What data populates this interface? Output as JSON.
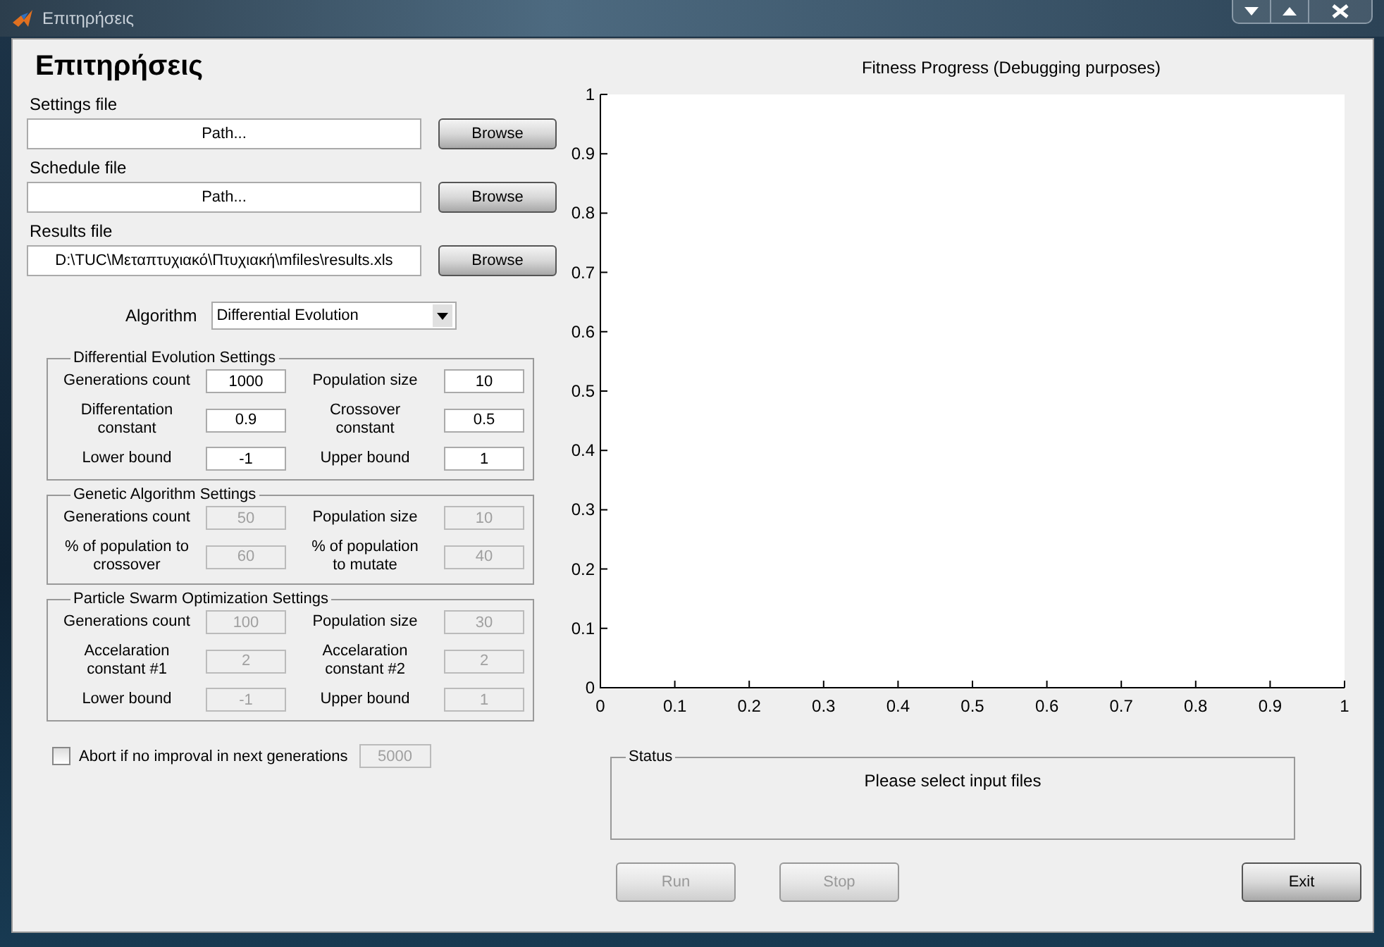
{
  "window": {
    "title": "Επιτηρήσεις"
  },
  "heading": "Επιτηρήσεις",
  "files": [
    {
      "label": "Settings file",
      "value": "Path...",
      "button": "Browse"
    },
    {
      "label": "Schedule file",
      "value": "Path...",
      "button": "Browse"
    },
    {
      "label": "Results file",
      "value": "D:\\TUC\\Μεταπτυχιακό\\Πτυχιακή\\mfiles\\results.xls",
      "button": "Browse"
    }
  ],
  "algorithm": {
    "label": "Algorithm",
    "value": "Differential Evolution"
  },
  "groups": [
    {
      "title": "Differential Evolution Settings",
      "disabled": false,
      "fields": [
        {
          "label": "Generations count",
          "value": "1000"
        },
        {
          "label": "Population size",
          "value": "10"
        },
        {
          "label": "Differentation constant",
          "value": "0.9"
        },
        {
          "label": "Crossover constant",
          "value": "0.5"
        },
        {
          "label": "Lower bound",
          "value": "-1"
        },
        {
          "label": "Upper bound",
          "value": "1"
        }
      ]
    },
    {
      "title": "Genetic Algorithm Settings",
      "disabled": true,
      "fields": [
        {
          "label": "Generations count",
          "value": "50"
        },
        {
          "label": "Population size",
          "value": "10"
        },
        {
          "label": "% of population to crossover",
          "value": "60"
        },
        {
          "label": "% of population to mutate",
          "value": "40"
        }
      ]
    },
    {
      "title": "Particle Swarm Optimization Settings",
      "disabled": true,
      "fields": [
        {
          "label": "Generations count",
          "value": "100"
        },
        {
          "label": "Population size",
          "value": "30"
        },
        {
          "label": "Accelaration constant #1",
          "value": "2"
        },
        {
          "label": "Accelaration constant #2",
          "value": "2"
        },
        {
          "label": "Lower bound",
          "value": "-1"
        },
        {
          "label": "Upper bound",
          "value": "1"
        }
      ]
    }
  ],
  "abort": {
    "label": "Abort if no improval in next generations",
    "checked": false,
    "value": "5000",
    "disabled": true
  },
  "chart": {
    "chart_data": {
      "type": "line",
      "title": "Fitness Progress (Debugging purposes)",
      "xlim": [
        0,
        1
      ],
      "ylim": [
        0,
        1
      ],
      "xticks": [
        {
          "value": 0,
          "label": "0"
        },
        {
          "value": 0.1,
          "label": "0.1"
        },
        {
          "value": 0.2,
          "label": "0.2"
        },
        {
          "value": 0.3,
          "label": "0.3"
        },
        {
          "value": 0.4,
          "label": "0.4"
        },
        {
          "value": 0.5,
          "label": "0.5"
        },
        {
          "value": 0.6,
          "label": "0.6"
        },
        {
          "value": 0.7,
          "label": "0.7"
        },
        {
          "value": 0.8,
          "label": "0.8"
        },
        {
          "value": 0.9,
          "label": "0.9"
        },
        {
          "value": 1,
          "label": "1"
        }
      ],
      "yticks": [
        {
          "value": 0,
          "label": "0"
        },
        {
          "value": 0.1,
          "label": "0.1"
        },
        {
          "value": 0.2,
          "label": "0.2"
        },
        {
          "value": 0.3,
          "label": "0.3"
        },
        {
          "value": 0.4,
          "label": "0.4"
        },
        {
          "value": 0.5,
          "label": "0.5"
        },
        {
          "value": 0.6,
          "label": "0.6"
        },
        {
          "value": 0.7,
          "label": "0.7"
        },
        {
          "value": 0.8,
          "label": "0.8"
        },
        {
          "value": 0.9,
          "label": "0.9"
        },
        {
          "value": 1,
          "label": "1"
        }
      ]
    }
  },
  "status": {
    "title": "Status",
    "message": "Please select input files"
  },
  "buttons": [
    {
      "label": "Run",
      "disabled": true
    },
    {
      "label": "Stop",
      "disabled": true
    },
    {
      "label": "Exit",
      "disabled": false
    }
  ]
}
